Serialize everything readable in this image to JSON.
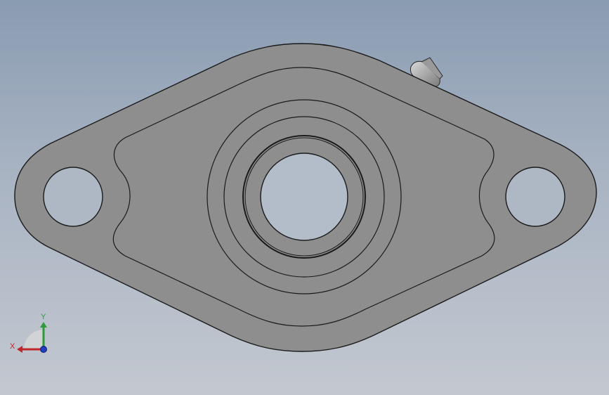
{
  "viewport": {
    "background_top": "#8a9cb2",
    "background_bottom": "#c3c8d0"
  },
  "model": {
    "part_type": "two-bolt flange bearing housing",
    "body_color": "#8e8e8e",
    "edge_color": "#1a1a1a",
    "grease_fitting": "grease-nipple",
    "holes": [
      "left-bolt-hole",
      "right-bolt-hole",
      "center-bore"
    ]
  },
  "triad": {
    "x_label": "X",
    "y_label": "Y",
    "x_color": "#c0272d",
    "y_color": "#2e9a3a",
    "z_color": "#1f3fbf"
  }
}
